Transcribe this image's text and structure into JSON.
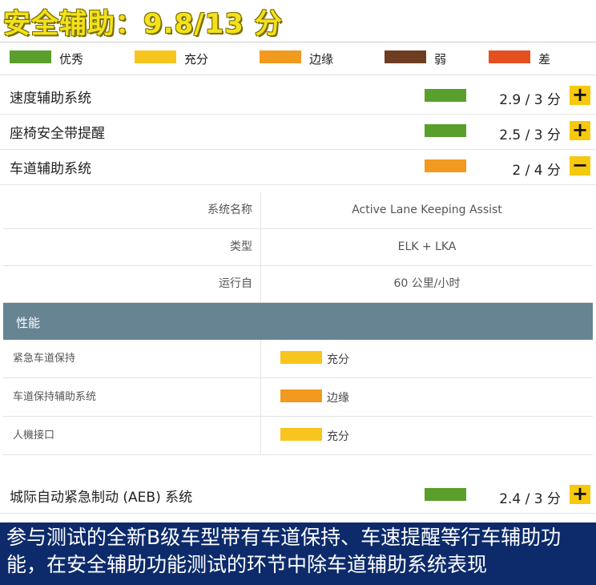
{
  "header": {
    "title": "安全辅助：9.8/13 分"
  },
  "legend": [
    {
      "label": "优秀",
      "color": "#5a9f2c"
    },
    {
      "label": "充分",
      "color": "#f7c51e"
    },
    {
      "label": "边缘",
      "color": "#f29a1f"
    },
    {
      "label": "弱",
      "color": "#6e3d22"
    },
    {
      "label": "差",
      "color": "#e4501f"
    }
  ],
  "rows": [
    {
      "label": "速度辅助系统",
      "score": "2.9 / 3 分",
      "rating": "优秀",
      "toggle": "+"
    },
    {
      "label": "座椅安全带提醒",
      "score": "2.5 / 3 分",
      "rating": "优秀",
      "toggle": "+"
    },
    {
      "label": "车道辅助系统",
      "score": "2 / 4 分",
      "rating": "边缘",
      "toggle": "−"
    }
  ],
  "details": [
    {
      "key": "系统名称",
      "value": "Active Lane Keeping Assist"
    },
    {
      "key": "类型",
      "value": "ELK + LKA"
    },
    {
      "key": "运行自",
      "value": "60 公里/小时"
    }
  ],
  "performance": {
    "header": "性能",
    "items": [
      {
        "label": "紧急车道保持",
        "rating": "充分"
      },
      {
        "label": "车道保持辅助系统",
        "rating": "边缘"
      },
      {
        "label": "人機接口",
        "rating": "充分"
      }
    ]
  },
  "aeb": {
    "label": "城际自动紧急制动 (AEB) 系统",
    "score": "2.4 / 3 分",
    "rating": "优秀",
    "toggle": "+"
  },
  "caption": "参与测试的全新B级车型带有车道保持、车速提醒等行车辅助功能，在安全辅助功能测试的环节中除车道辅助系统表现"
}
